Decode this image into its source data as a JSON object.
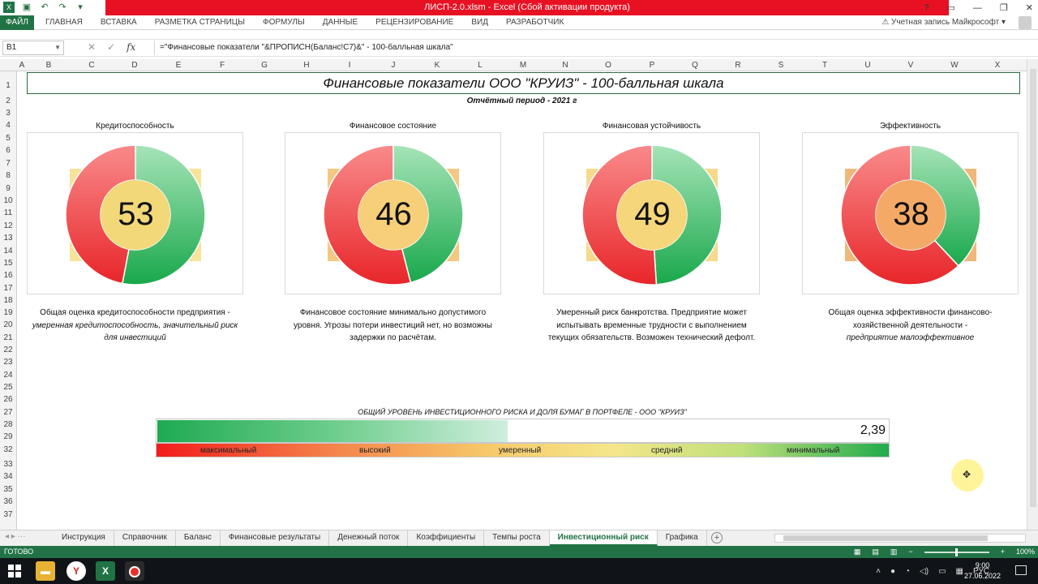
{
  "window": {
    "title": "ЛИСП-2.0.xlsm -  Excel (Сбой активации продукта)",
    "controls": [
      "?",
      "▭",
      "—",
      "❐",
      "✕"
    ]
  },
  "ribbon": {
    "file_tab": "ФАЙЛ",
    "tabs": [
      "ГЛАВНАЯ",
      "ВСТАВКА",
      "РАЗМЕТКА СТРАНИЦЫ",
      "ФОРМУЛЫ",
      "ДАННЫЕ",
      "РЕЦЕНЗИРОВАНИЕ",
      "ВИД",
      "РАЗРАБОТЧИК"
    ],
    "account": "⚠ Учетная запись Майкрософт ▾"
  },
  "formula_bar": {
    "name_box": "B1",
    "fx_label": "fx",
    "formula": "=\"Финансовые показатели \"&ПРОПИСН(Баланс!C7)&\" - 100-балльная шкала\""
  },
  "columns": [
    "A",
    "B",
    "C",
    "D",
    "E",
    "F",
    "G",
    "H",
    "I",
    "J",
    "K",
    "L",
    "M",
    "N",
    "O",
    "P",
    "Q",
    "R",
    "S",
    "T",
    "U",
    "V",
    "W",
    "X"
  ],
  "rows": [
    "1",
    "2",
    "3",
    "4",
    "5",
    "6",
    "7",
    "8",
    "9",
    "10",
    "11",
    "12",
    "13",
    "14",
    "15",
    "16",
    "17",
    "18",
    "19",
    "20",
    "21",
    "22",
    "23",
    "24",
    "25",
    "26",
    "27",
    "28",
    "29",
    "32",
    "33",
    "34",
    "35",
    "36",
    "37",
    "38"
  ],
  "report": {
    "title": "Финансовые показатели ООО \"КРУИЗ\" - 100-балльная шкала",
    "subtitle": "Отчётный период - 2021 г"
  },
  "gauges": [
    {
      "title": "Кредитоспособность",
      "value": 53,
      "desc_plain": "Общая оценка кредитоспособности предприятия -",
      "desc_italic": "умеренная кредитоспособность, значительный риск для инвестиций",
      "center_color": "#f3d87a",
      "square_color": "#f7e39a"
    },
    {
      "title": "Финансовое состояние",
      "value": 46,
      "desc_plain": "Финансовое состояние минимально допустимого уровня. Угрозы потери инвестиций нет, но возможны задержки по расчётам.",
      "desc_italic": "",
      "center_color": "#f6cf78",
      "square_color": "#f4c882"
    },
    {
      "title": "Финансовая устойчивость",
      "value": 49,
      "desc_plain": "Умеренный риск банкротства. Предприятие может испытывать временные трудности с выполнением текущих обязательств. Возможен технический дефолт.",
      "desc_italic": "",
      "center_color": "#f6d67a",
      "square_color": "#f6d98d"
    },
    {
      "title": "Эффективность",
      "value": 38,
      "desc_plain": "Общая оценка эффективности финансово-хозяйственной деятельности -",
      "desc_italic": "предприятие малоэффективное",
      "center_color": "#f4aa66",
      "square_color": "#f0b77a"
    }
  ],
  "risk": {
    "title": "ОБЩИЙ УРОВЕНЬ ИНВЕСТИЦИОННОГО РИСКА И ДОЛЯ БУМАГ В ПОРТФЕЛЕ - ООО \"КРУИЗ\"",
    "value_label": "2,39",
    "fill_fraction": 0.478,
    "scale_labels": [
      "максимальный",
      "высокий",
      "умеренный",
      "средний",
      "минимальный"
    ]
  },
  "sheet_tabs": [
    "Инструкция",
    "Справочник",
    "Баланс",
    "Финансовые результаты",
    "Денежный поток",
    "Коэффициенты",
    "Темпы роста",
    "Инвестиционный риск",
    "Графика"
  ],
  "active_sheet": "Инвестиционный риск",
  "status": {
    "ready": "ГОТОВО",
    "zoom": "100%"
  },
  "taskbar": {
    "lang": "РУС",
    "time": "9:00",
    "date": "27.06.2022"
  },
  "colors": {
    "excel_green": "#217346",
    "title_red": "#e81123",
    "gauge_red": "#e8262a",
    "gauge_green": "#19a84b"
  }
}
